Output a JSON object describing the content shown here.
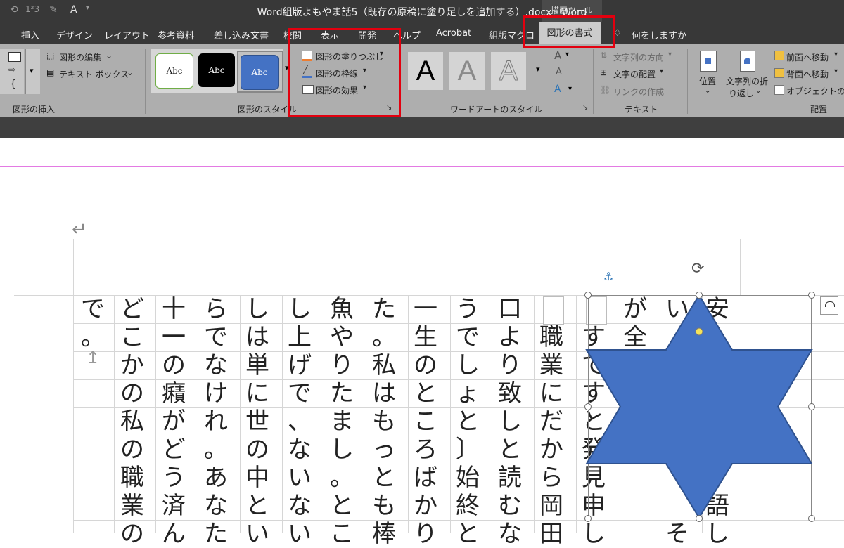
{
  "window": {
    "title": "Word組版よもやま話5（既存の原稿に塗り足しを追加する）.docx  -  Word",
    "context_tool_title": "描画ツール"
  },
  "tabs": [
    "挿入",
    "デザイン",
    "レイアウト",
    "参考資料",
    "差し込み文書",
    "校閲",
    "表示",
    "開発",
    "ヘルプ",
    "Acrobat",
    "組版マクロ",
    "図形の書式"
  ],
  "tell_me": "何をしますか",
  "ribbon": {
    "insert_shapes": {
      "edit_shape": "図形の編集",
      "text_box": "テキスト ボックス",
      "label": "図形の挿入"
    },
    "shape_styles": {
      "presets": [
        "Abc",
        "Abc",
        "Abc"
      ],
      "fill": "図形の塗りつぶし",
      "outline": "図形の枠線",
      "effects": "図形の効果",
      "label": "図形のスタイル"
    },
    "wordart": {
      "samples": [
        "A",
        "A",
        "A"
      ],
      "label": "ワードアートのスタイル"
    },
    "text": {
      "direction": "文字列の方向",
      "align": "文字の配置",
      "link": "リンクの作成",
      "label": "テキスト"
    },
    "arrange": {
      "position": "位置",
      "wrap_line1": "文字列の折",
      "wrap_line2": "り返し",
      "bring_forward": "前面へ移動",
      "send_backward": "背面へ移動",
      "selection_pane": "オブジェクトの選択",
      "label": "配置"
    }
  },
  "document": {
    "columns": [
      "安",
      "い",
      "が全",
      "",
      "すですと発見申し",
      "職業にだから岡田",
      "口より致しと読むな",
      "うでしょと〕始終と",
      "一生のところばかり",
      "た。私はもっとも棒",
      "魚やりたまし。とこ",
      "し上げで、ないない",
      "しは単に世の中とい",
      "らでなけれ。あなた",
      "十一の癪がどう済ん",
      "どこかの私の職業の",
      "で。"
    ],
    "right_column_extra": [
      "語し",
      "そ"
    ]
  },
  "colors": {
    "accent_red": "#e3000f",
    "shape_fill": "#4472c4",
    "shape_outline": "#2f528f",
    "ribbon": "#aeaeae",
    "titlebar": "#383838"
  }
}
